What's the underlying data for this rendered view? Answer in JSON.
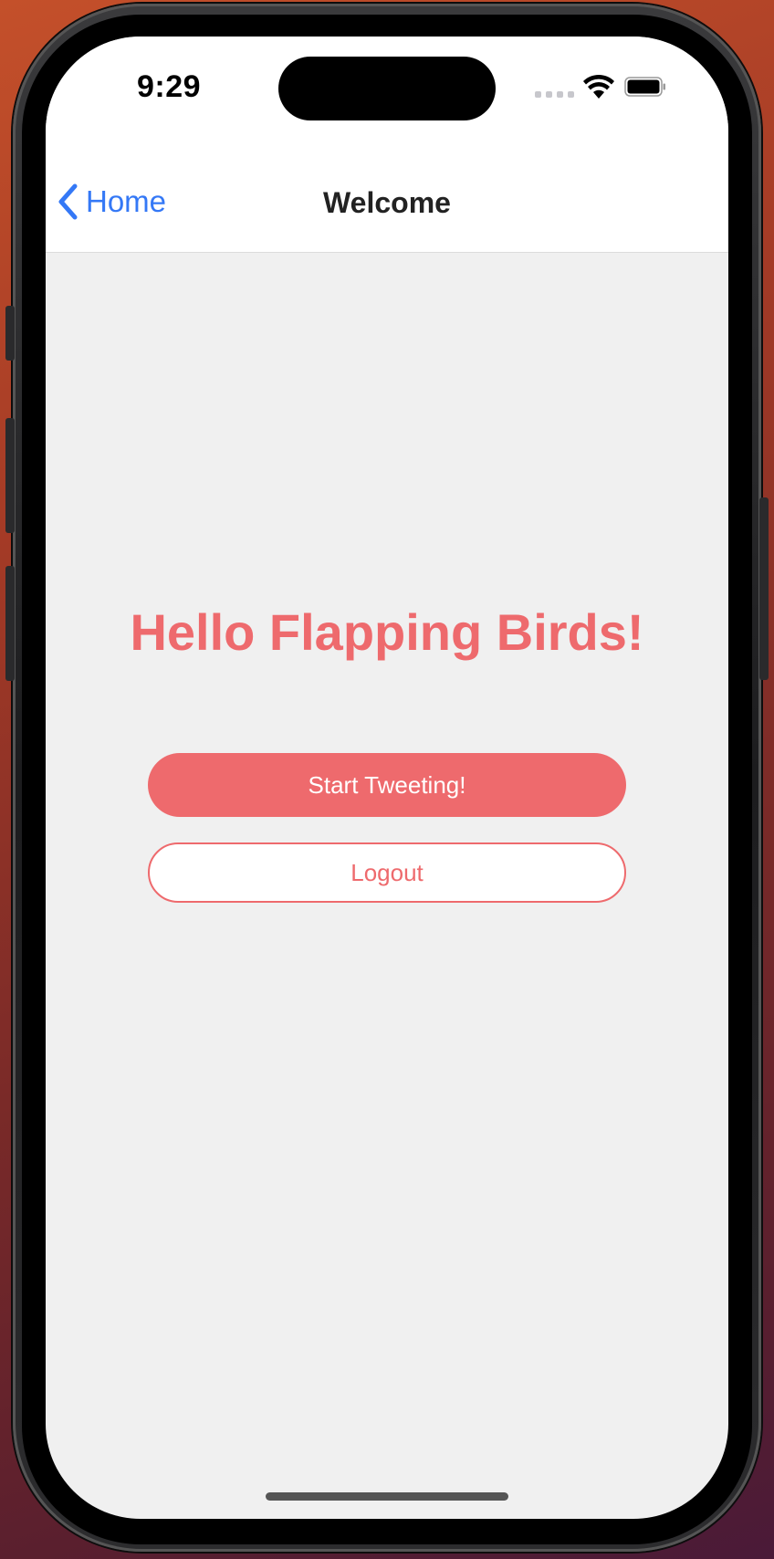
{
  "status_bar": {
    "time": "9:29"
  },
  "nav": {
    "back_label": "Home",
    "title": "Welcome"
  },
  "main": {
    "headline": "Hello Flapping Birds!",
    "primary_button": "Start Tweeting!",
    "secondary_button": "Logout"
  },
  "colors": {
    "accent": "#ee6a6d",
    "link": "#3478f6",
    "background": "#f0f0f0"
  },
  "icons": [
    "chevron-left-icon",
    "wifi-icon",
    "battery-icon",
    "cellular-signal-icon"
  ]
}
